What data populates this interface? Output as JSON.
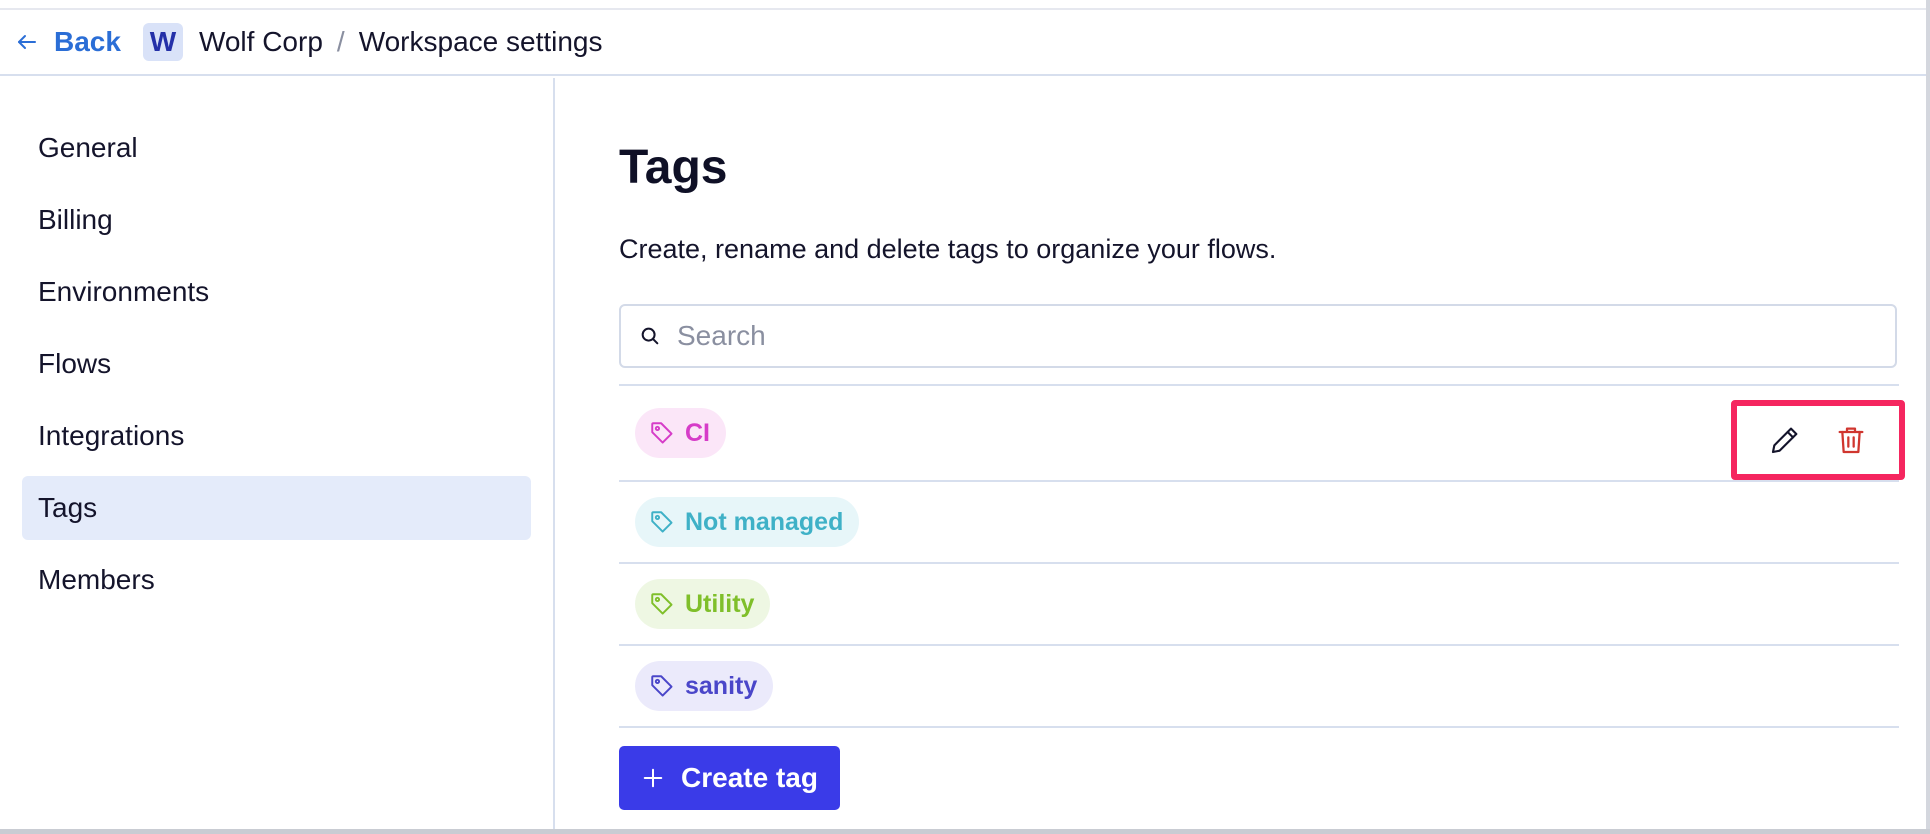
{
  "header": {
    "back_label": "Back",
    "back_icon": "arrow-left-icon",
    "workspace_initial": "W",
    "workspace_name": "Wolf Corp",
    "separator": "/",
    "page_name": "Workspace settings"
  },
  "sidebar": {
    "items": [
      {
        "label": "General",
        "active": false
      },
      {
        "label": "Billing",
        "active": false
      },
      {
        "label": "Environments",
        "active": false
      },
      {
        "label": "Flows",
        "active": false
      },
      {
        "label": "Integrations",
        "active": false
      },
      {
        "label": "Tags",
        "active": true
      },
      {
        "label": "Members",
        "active": false
      }
    ]
  },
  "main": {
    "title": "Tags",
    "description": "Create, rename and delete tags to organize your flows.",
    "search": {
      "placeholder": "Search",
      "value": "",
      "icon": "search-icon"
    },
    "tags": [
      {
        "label": "CI",
        "color": "#d63cc8",
        "background": "#fbe6f8"
      },
      {
        "label": "Not managed",
        "color": "#3fb1c7",
        "background": "#e7f6f9"
      },
      {
        "label": "Utility",
        "color": "#7fbf2a",
        "background": "#eef7e3"
      },
      {
        "label": "sanity",
        "color": "#4a46c9",
        "background": "#ebeafb"
      }
    ],
    "row_actions": {
      "edit_icon": "pencil-icon",
      "delete_icon": "trash-icon",
      "highlight_color": "#f5265f"
    },
    "create_button": {
      "label": "Create tag",
      "icon": "plus-icon",
      "background": "#3a3be8"
    }
  },
  "colors": {
    "link": "#2b6ed6",
    "active_nav": "#e4ebfa",
    "border": "#d7dfee",
    "delete": "#d0362f"
  }
}
